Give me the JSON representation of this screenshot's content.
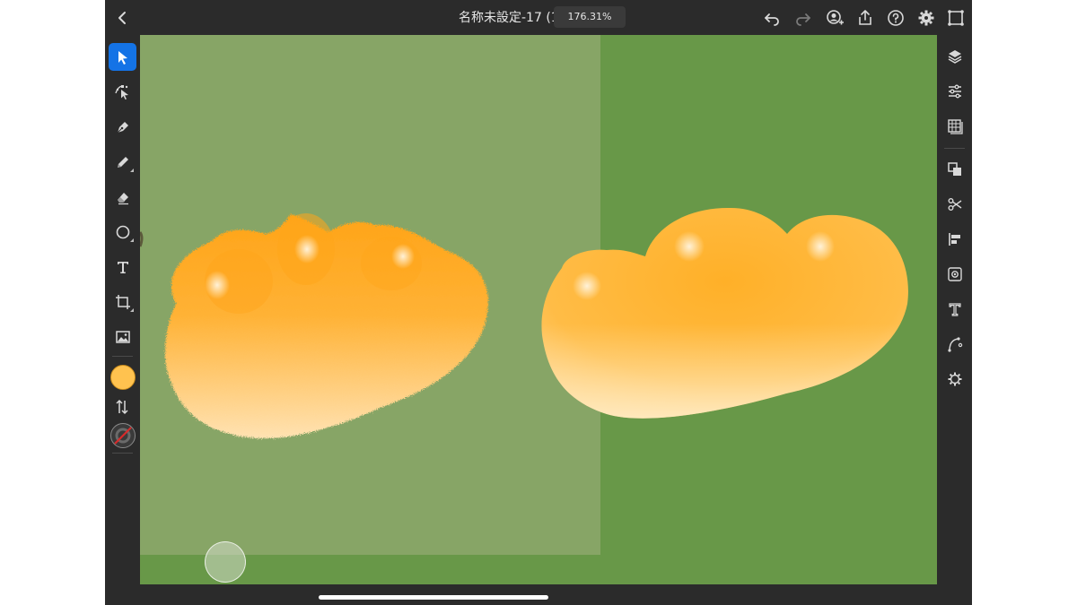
{
  "header": {
    "title": "名称未設定-17 (1)",
    "zoom": "176.31%"
  },
  "toolbar_icons": {
    "back": "chevron-left-icon",
    "undo": "undo-icon",
    "redo": "redo-icon",
    "invite": "invite-user-icon",
    "share": "share-icon",
    "help": "help-icon",
    "settings": "gear-icon",
    "fit": "fit-screen-icon"
  },
  "left_tools": [
    {
      "name": "select-tool",
      "icon": "pointer-icon",
      "active": true
    },
    {
      "name": "direct-select-tool",
      "icon": "node-select-icon"
    },
    {
      "name": "pen-tool",
      "icon": "pen-icon"
    },
    {
      "name": "pencil-tool",
      "icon": "pencil-icon"
    },
    {
      "name": "eraser-tool",
      "icon": "eraser-icon"
    },
    {
      "name": "shape-tool",
      "icon": "circle-icon"
    },
    {
      "name": "type-tool",
      "icon": "type-icon"
    },
    {
      "name": "transform-tool",
      "icon": "transform-icon"
    },
    {
      "name": "image-tool",
      "icon": "image-icon"
    }
  ],
  "colors": {
    "fill": "#ffc24f",
    "stroke": "none",
    "canvas": "#689848",
    "accent": "#1473e6"
  },
  "right_tools": [
    {
      "name": "layers-button",
      "icon": "layers-icon"
    },
    {
      "name": "properties-button",
      "icon": "sliders-icon"
    },
    {
      "name": "libraries-button",
      "icon": "grid-icon"
    },
    {
      "name": "arrange-button",
      "icon": "arrange-icon"
    },
    {
      "name": "scissors-button",
      "icon": "scissors-icon"
    },
    {
      "name": "align-button",
      "icon": "align-left-icon"
    },
    {
      "name": "recolor-button",
      "icon": "recolor-icon"
    },
    {
      "name": "type-properties-button",
      "icon": "type-properties-icon"
    },
    {
      "name": "path-button",
      "icon": "path-icon"
    },
    {
      "name": "plugins-button",
      "icon": "gear-cog-icon"
    }
  ]
}
